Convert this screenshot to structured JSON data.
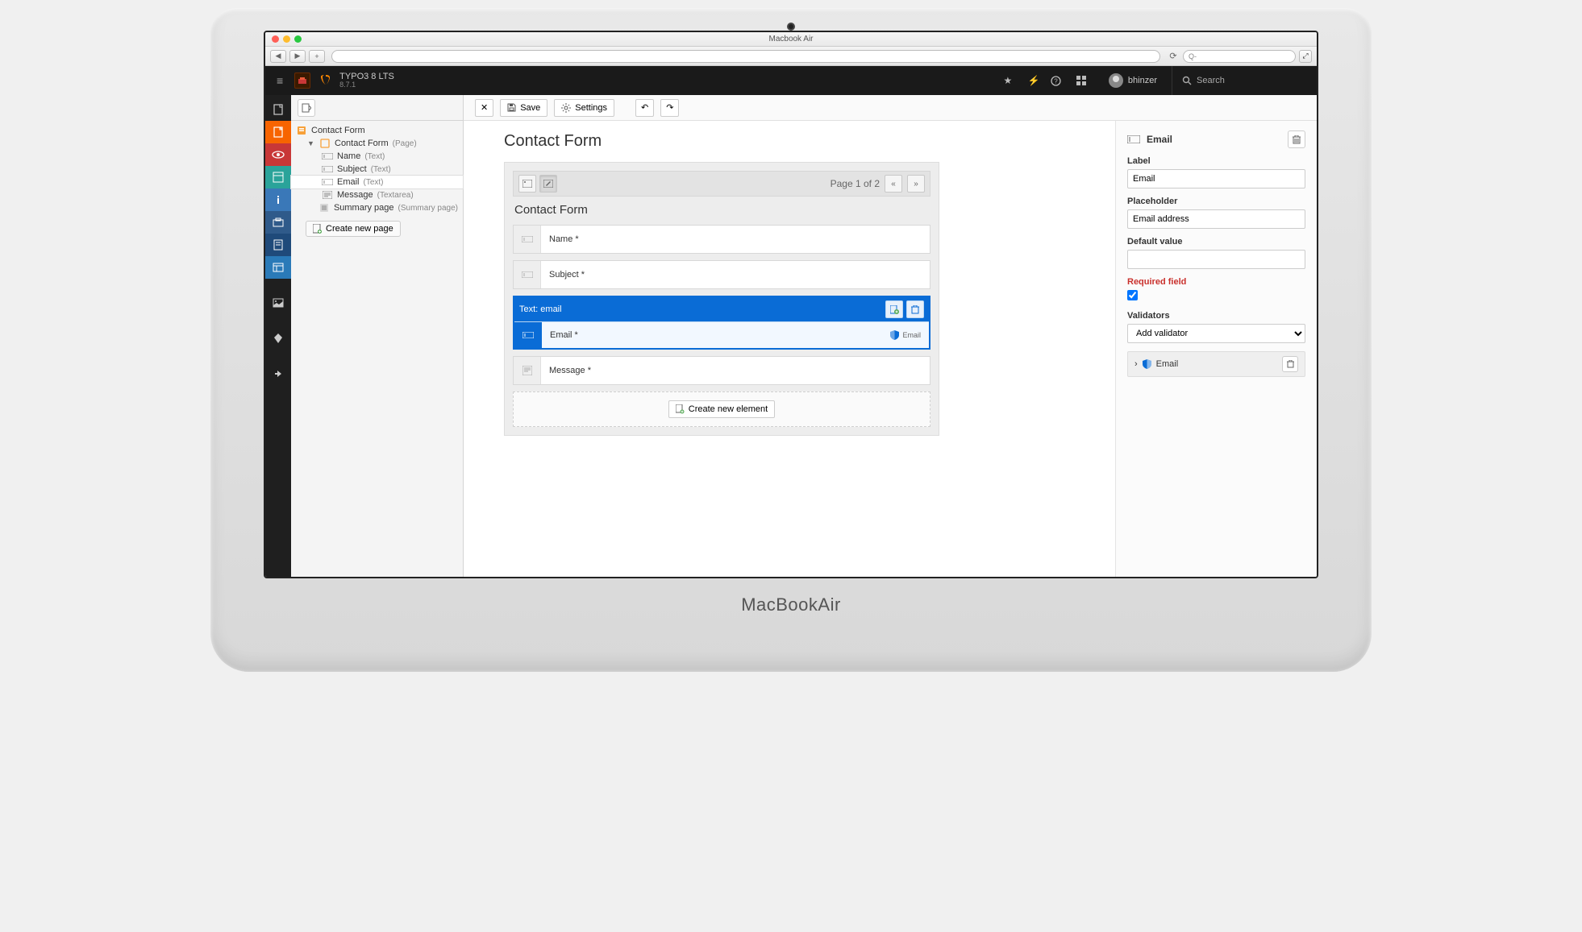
{
  "mac": {
    "title": "Macbook Air",
    "search_prefix": "Q-"
  },
  "brand": {
    "name": "TYPO3 8 LTS",
    "version": "8.7.1"
  },
  "top": {
    "username": "bhinzer",
    "search_placeholder": "Search"
  },
  "toolbar": {
    "save": "Save",
    "settings": "Settings"
  },
  "tree": {
    "root": "Contact Form",
    "page": "Contact Form",
    "page_suffix": "(Page)",
    "items": [
      {
        "label": "Name",
        "suffix": "(Text)"
      },
      {
        "label": "Subject",
        "suffix": "(Text)"
      },
      {
        "label": "Email",
        "suffix": "(Text)",
        "selected": true
      },
      {
        "label": "Message",
        "suffix": "(Textarea)"
      }
    ],
    "summary": "Summary page",
    "summary_suffix": "(Summary page)",
    "create_page": "Create new page"
  },
  "editor": {
    "title": "Contact Form",
    "form_title": "Contact Form",
    "pager": "Page 1 of 2",
    "fields": {
      "name": "Name *",
      "subject": "Subject *",
      "email_type": "Text: email",
      "email": "Email *",
      "email_badge": "Email",
      "message": "Message *"
    },
    "create_element": "Create new element"
  },
  "inspector": {
    "heading": "Email",
    "label_lbl": "Label",
    "label_val": "Email",
    "placeholder_lbl": "Placeholder",
    "placeholder_val": "Email address",
    "default_lbl": "Default value",
    "default_val": "",
    "required_lbl": "Required field",
    "validators_lbl": "Validators",
    "add_validator": "Add validator",
    "validator_item": "Email"
  },
  "footer_brand": {
    "a": "MacBook",
    "b": "Air"
  }
}
